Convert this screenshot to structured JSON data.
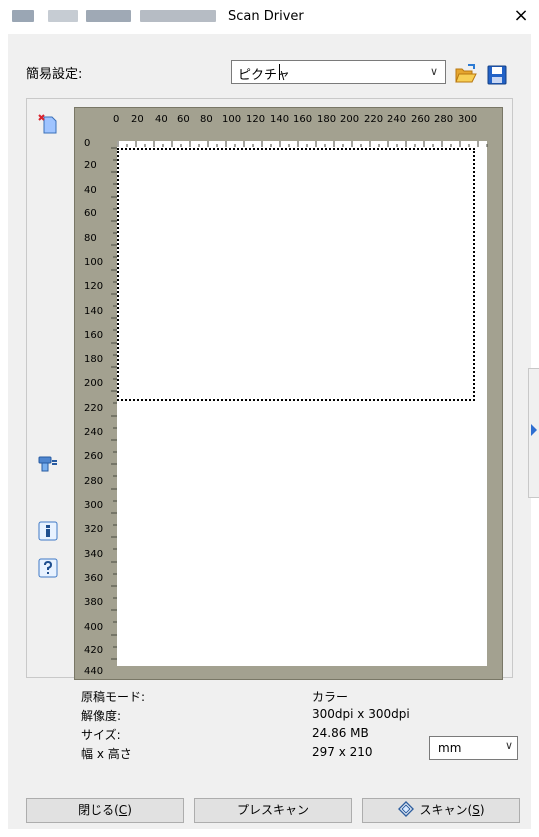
{
  "window": {
    "title": "Scan Driver",
    "close_symbol": "×"
  },
  "preset": {
    "label": "簡易設定:",
    "value": "ピクチャ",
    "dropdown_symbol": "∨"
  },
  "toolbar": {
    "open_icon": "folder-open-icon",
    "save_icon": "save-disk-icon"
  },
  "preview": {
    "top_ruler": [
      "0",
      "20",
      "40",
      "60",
      "80",
      "100",
      "120",
      "140",
      "160",
      "180",
      "200",
      "220",
      "240",
      "260",
      "280",
      "300"
    ],
    "left_ruler": [
      "0",
      "20",
      "40",
      "60",
      "80",
      "100",
      "120",
      "140",
      "160",
      "180",
      "200",
      "220",
      "240",
      "260",
      "280",
      "300",
      "320",
      "340",
      "360",
      "380",
      "400",
      "420",
      "440"
    ]
  },
  "side_icons": {
    "clear": "clear-preview-icon",
    "scanner": "scanner-icon",
    "info": "info-icon",
    "help": "help-icon"
  },
  "info": {
    "mode_label": "原稿モード:",
    "mode_value": "カラー",
    "resolution_label": "解像度:",
    "resolution_value": "300dpi x 300dpi",
    "size_label": "サイズ:",
    "size_value": "24.86 MB",
    "dimension_label": "幅 x 高さ",
    "dimension_value": "297 x 210",
    "unit_value": "mm",
    "unit_dropdown_symbol": "∨"
  },
  "buttons": {
    "close_prefix": "閉じる(",
    "close_key": "C",
    "close_suffix": ")",
    "prescan": "プレスキャン",
    "scan_prefix": "スキャン(",
    "scan_key": "S",
    "scan_suffix": ")"
  }
}
